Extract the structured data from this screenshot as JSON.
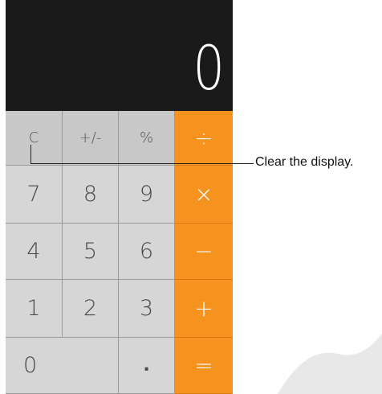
{
  "display": {
    "value": "0"
  },
  "keys": {
    "row1": [
      "C",
      "+/-",
      "%",
      "÷"
    ],
    "row2": [
      "7",
      "8",
      "9",
      "×"
    ],
    "row3": [
      "4",
      "5",
      "6",
      "−"
    ],
    "row4": [
      "1",
      "2",
      "3",
      "+"
    ],
    "row5": [
      "0",
      ".",
      "="
    ]
  },
  "callout": {
    "text": "Clear the display."
  },
  "colors": {
    "display_bg": "#1a1a1a",
    "key_bg": "#d4d4d4",
    "operator_bg": "#f6921e",
    "operator_text": "#ffffff"
  },
  "icons": {
    "watermark": "watermark-shape"
  }
}
